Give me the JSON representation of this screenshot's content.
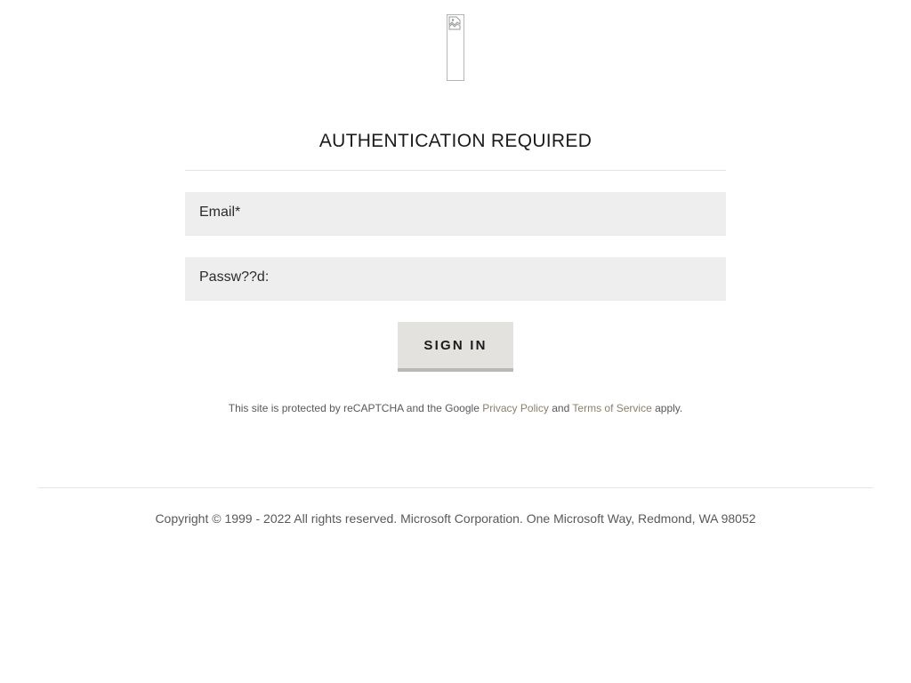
{
  "logo": {
    "icon": "broken-image-icon"
  },
  "auth": {
    "title": "AUTHENTICATION REQUIRED",
    "email_label": "Email*",
    "email_value": "",
    "password_label": "Passw??d:",
    "password_value": "",
    "signin_label": "SIGN IN"
  },
  "recaptcha": {
    "prefix": "This site is protected by reCAPTCHA and the Google",
    "privacy_link": "Privacy Policy",
    "and_text": "and",
    "terms_link": "Terms of Service",
    "suffix": "apply."
  },
  "footer": {
    "copyright": "Copyright © 1999 - 2022 All rights reserved. Microsoft Corporation. One Microsoft Way, Redmond, WA 98052"
  },
  "colors": {
    "field_bg": "#eeeeee",
    "button_bg": "#e4e2df",
    "link": "#8c7f6b",
    "text": "#1b1b1b"
  }
}
